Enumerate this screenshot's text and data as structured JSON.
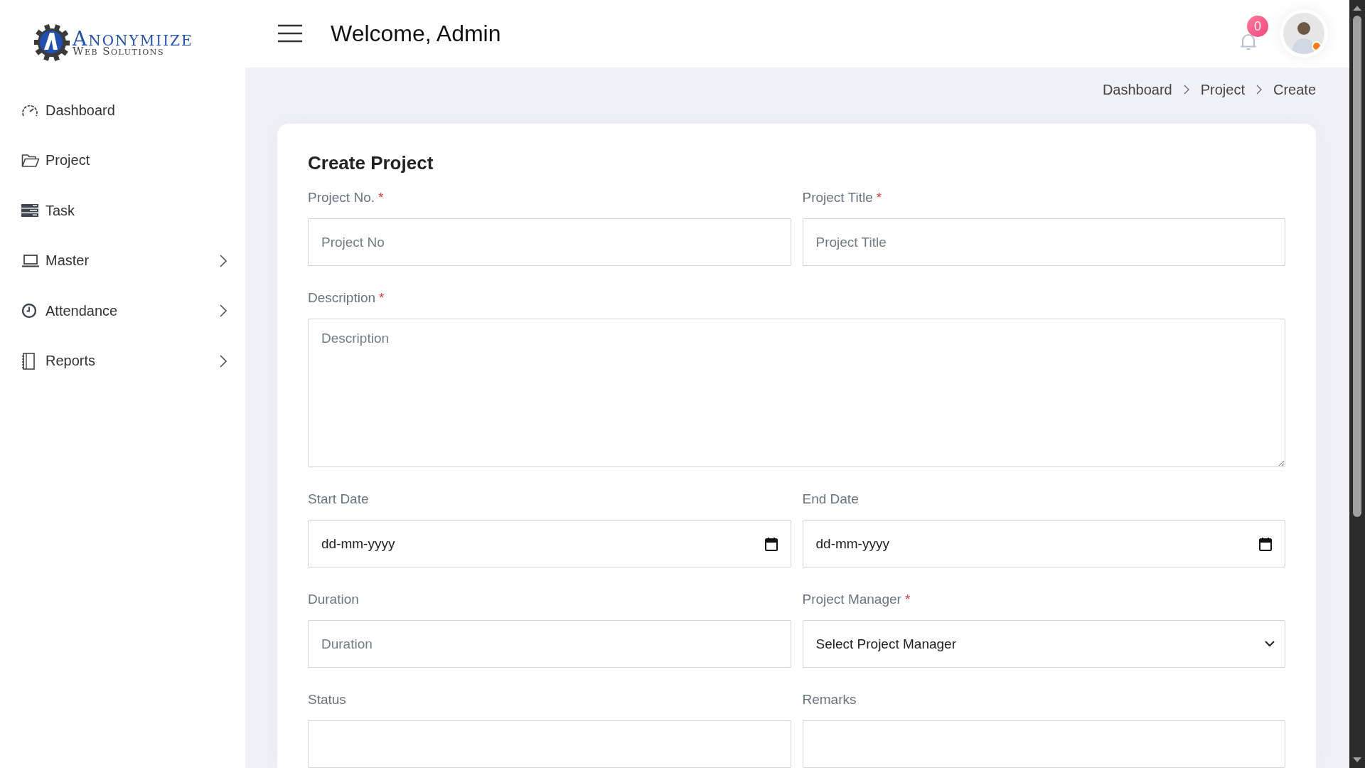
{
  "logo": {
    "name": "Anonymiize",
    "tagline": "Web Solutions"
  },
  "sidebar": {
    "items": [
      {
        "label": "Dashboard",
        "expandable": false
      },
      {
        "label": "Project",
        "expandable": false
      },
      {
        "label": "Task",
        "expandable": false
      },
      {
        "label": "Master",
        "expandable": true
      },
      {
        "label": "Attendance",
        "expandable": true
      },
      {
        "label": "Reports",
        "expandable": true
      }
    ]
  },
  "header": {
    "title": "Welcome, Admin",
    "notifications": "0"
  },
  "breadcrumb": [
    "Dashboard",
    "Project",
    "Create"
  ],
  "form": {
    "title": "Create Project",
    "fields": [
      {
        "kind": "text",
        "label": "Project No.",
        "mark": "*",
        "placeholder": "Project No",
        "wide": false
      },
      {
        "kind": "text",
        "label": "Project Title",
        "mark": "*",
        "placeholder": "Project Title",
        "wide": false
      },
      {
        "kind": "textarea",
        "label": "Description",
        "mark": "*",
        "placeholder": "Description",
        "wide": true
      },
      {
        "kind": "date",
        "label": "Start Date",
        "value": "dd-mm-yyyy",
        "wide": false
      },
      {
        "kind": "date",
        "label": "End Date",
        "value": "dd-mm-yyyy",
        "wide": false
      },
      {
        "kind": "text",
        "label": "Duration",
        "placeholder": "Duration",
        "wide": false
      },
      {
        "kind": "select",
        "label": "Project Manager",
        "mark": "*",
        "value": "Select Project Manager",
        "wide": false
      },
      {
        "kind": "text",
        "label": "Status",
        "wide": false
      },
      {
        "kind": "text",
        "label": "Remarks",
        "wide": false
      }
    ]
  }
}
